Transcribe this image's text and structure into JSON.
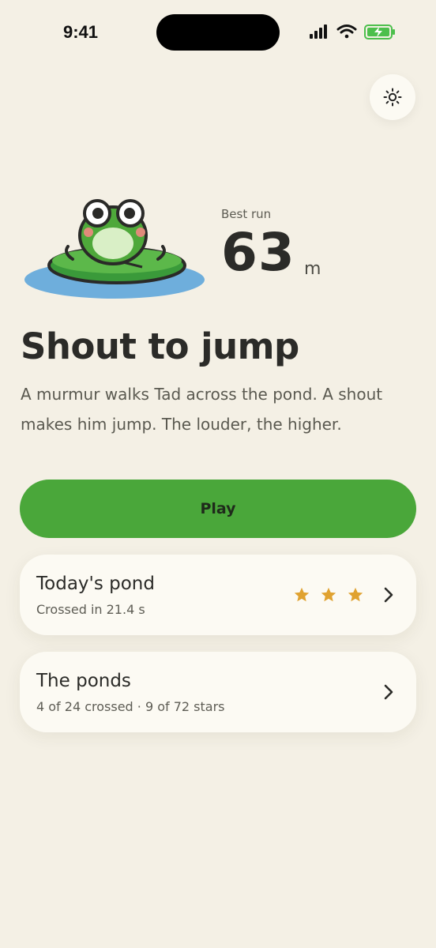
{
  "status_bar": {
    "time": "9:41",
    "icons": [
      "cellular-signal-icon",
      "wifi-icon",
      "battery-charging-icon"
    ]
  },
  "theme_toggle": {
    "icon": "sun-icon"
  },
  "hero": {
    "mascot_icon": "frog-on-lily-pad-icon",
    "best_label": "Best run",
    "best_value": "63",
    "best_unit": "m"
  },
  "title": "Shout to jump",
  "description": "A murmur walks Tad across the pond. A shout makes him jump. The louder, the higher.",
  "play_label": "Play",
  "cards": [
    {
      "title": "Today's pond",
      "subtitle": "Crossed in 21.4 s",
      "stars": 3,
      "star_color": "#e0a230"
    },
    {
      "title": "The ponds",
      "subtitle": "4 of 24 crossed · 9 of 72 stars"
    }
  ],
  "colors": {
    "background": "#f4f0e5",
    "accent": "#4aa73a",
    "card": "#fcfaf3",
    "text": "#2b2b28"
  }
}
